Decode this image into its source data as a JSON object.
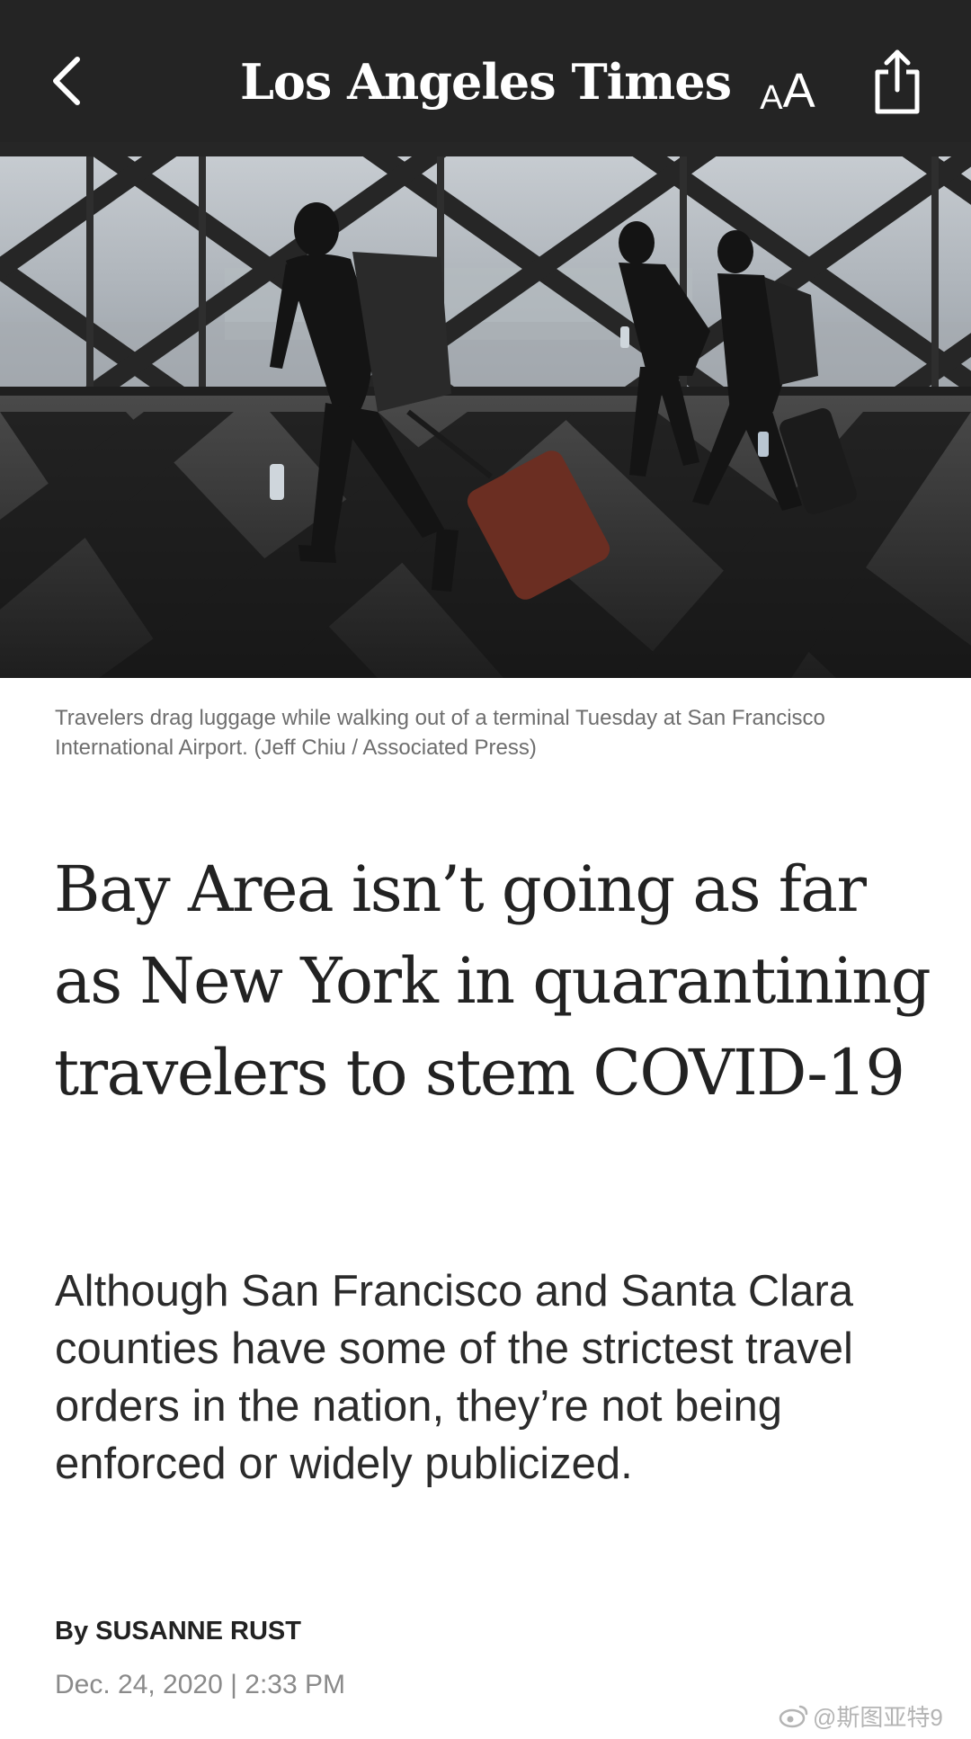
{
  "header": {
    "back_icon": "chevron-left-icon",
    "masthead": "Los Angeles Times",
    "text_size_label_small": "A",
    "text_size_label_large": "A",
    "share_icon": "share-icon",
    "background": "#242424"
  },
  "hero_image": {
    "caption": "Travelers drag luggage while walking out of a terminal Tuesday at San Francisco International Airport. (Jeff Chiu / Associated Press)"
  },
  "article": {
    "headline": "Bay Area isn’t going as far as New York in quarantining travelers to stem COVID-19",
    "dek": "Although San Francisco and Santa Clara counties have some of the strictest travel orders in the nation, they’re not being enforced or widely publicized.",
    "byline_prefix": "By",
    "author": "SUSANNE RUST",
    "date": "Dec. 24, 2020 | 2:33 PM"
  },
  "watermark": {
    "icon": "weibo-icon",
    "text": "@斯图亚特9"
  }
}
